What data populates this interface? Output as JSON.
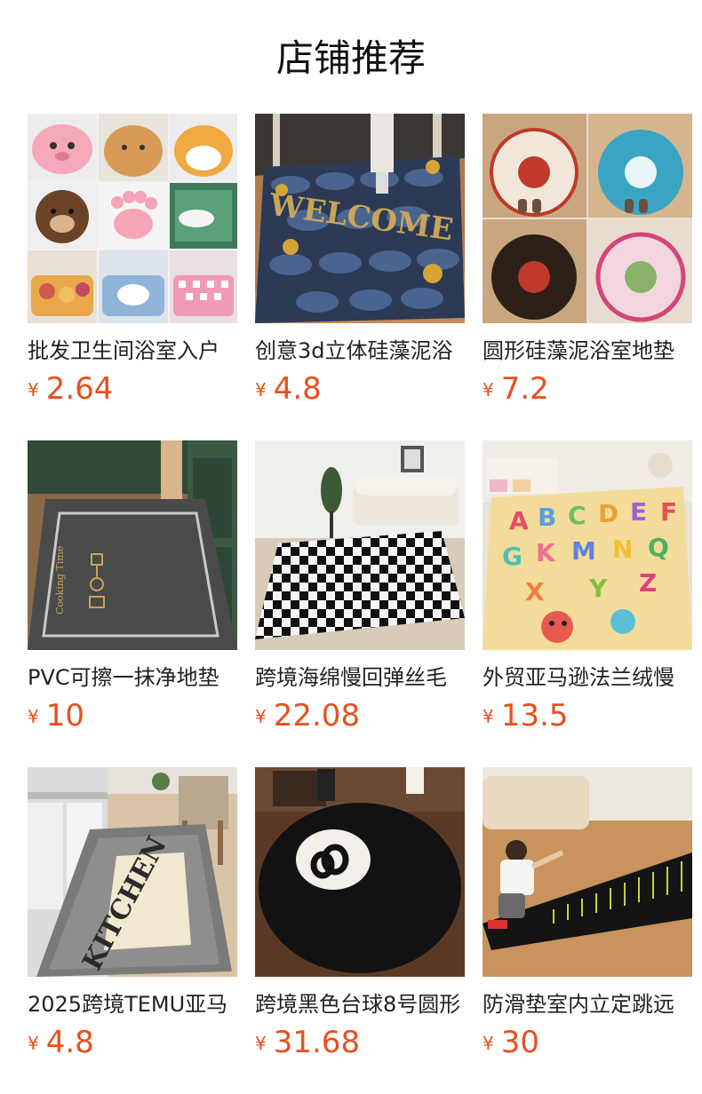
{
  "header": {
    "title": "店铺推荐"
  },
  "products": [
    {
      "name": "批发卫生间浴室入户",
      "currency": "¥",
      "price": "2.64",
      "image": "cartoon-animal-bath-mats"
    },
    {
      "name": "创意3d立体硅藻泥浴",
      "currency": "¥",
      "price": "4.8",
      "image": "welcome-stone-door-mat"
    },
    {
      "name": "圆形硅藻泥浴室地垫",
      "currency": "¥",
      "price": "7.2",
      "image": "round-floral-diatom-mats"
    },
    {
      "name": "PVC可擦一抹净地垫",
      "currency": "¥",
      "price": "10",
      "image": "cooking-time-kitchen-mat"
    },
    {
      "name": "跨境海绵慢回弹丝毛",
      "currency": "¥",
      "price": "22.08",
      "image": "checkered-shag-rug"
    },
    {
      "name": "外贸亚马逊法兰绒慢",
      "currency": "¥",
      "price": "13.5",
      "image": "kids-alphabet-rug"
    },
    {
      "name": "2025跨境TEMU亚马",
      "currency": "¥",
      "price": "4.8",
      "image": "kitchen-runner-mat"
    },
    {
      "name": "跨境黑色台球8号圆形",
      "currency": "¥",
      "price": "31.68",
      "image": "eight-ball-round-rug"
    },
    {
      "name": "防滑垫室内立定跳远",
      "currency": "¥",
      "price": "30",
      "image": "long-jump-training-mat"
    }
  ]
}
